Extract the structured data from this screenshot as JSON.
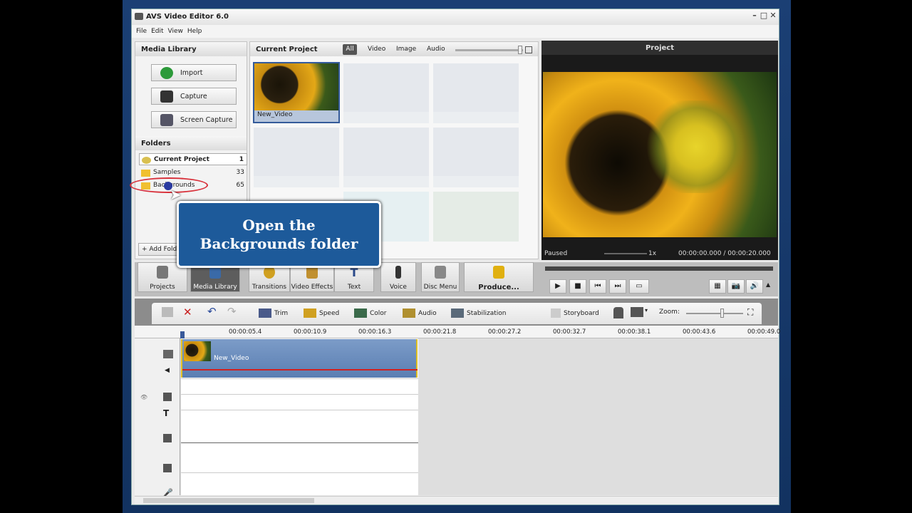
{
  "window": {
    "title": "AVS Video Editor 6.0"
  },
  "menu": [
    "File",
    "Edit",
    "View",
    "Help"
  ],
  "media_library": {
    "title": "Media Library",
    "buttons": [
      "Import",
      "Capture",
      "Screen Capture"
    ],
    "folders_title": "Folders",
    "folders": [
      {
        "name": "Current Project",
        "count": "1"
      },
      {
        "name": "Samples",
        "count": "33"
      },
      {
        "name": "Backgrounds",
        "count": "65"
      }
    ],
    "add_folder": "+ Add Fold"
  },
  "current_project": {
    "title": "Current Project",
    "filters": [
      "All",
      "Video",
      "Image",
      "Audio"
    ],
    "items": [
      {
        "name": "New_Video"
      }
    ]
  },
  "preview": {
    "title": "Project",
    "status": "Paused",
    "speed": "1x",
    "time": "00:00:00.000 / 00:00:20.000"
  },
  "tooltip": "Open the Backgrounds folder",
  "main_toolbar": [
    "Projects",
    "Media Library",
    "Transitions",
    "Video Effects",
    "Text",
    "Voice",
    "Disc Menu",
    "Produce..."
  ],
  "timeline_toolbar": {
    "tools": [
      "Trim",
      "Speed",
      "Color",
      "Audio",
      "Stabilization"
    ],
    "storyboard": "Storyboard",
    "zoom": "Zoom:"
  },
  "ruler": [
    "00:00:05.4",
    "00:00:10.9",
    "00:00:16.3",
    "00:00:21.8",
    "00:00:27.2",
    "00:00:32.7",
    "00:00:38.1",
    "00:00:43.6",
    "00:00:49.0"
  ],
  "timeline_clip": "New_Video"
}
